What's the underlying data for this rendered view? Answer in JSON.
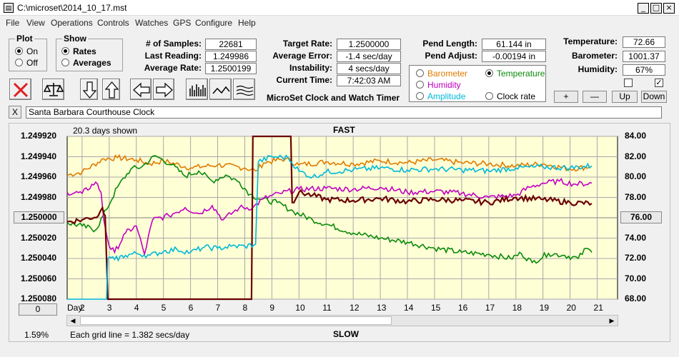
{
  "window": {
    "title": "C:\\microset\\2014_10_17.mst",
    "icon": "app-icon",
    "controls": [
      "_",
      "□",
      "×"
    ]
  },
  "menu": [
    "File",
    "View",
    "Operations",
    "Controls",
    "Watches",
    "GPS",
    "Configure",
    "Help"
  ],
  "plot_group": {
    "title": "Plot",
    "options": [
      "On",
      "Off"
    ],
    "selected": "On"
  },
  "show_group": {
    "title": "Show",
    "options": [
      "Rates",
      "Averages"
    ],
    "selected": "Rates"
  },
  "stats": {
    "samples_label": "# of Samples:",
    "samples": "22681",
    "last_reading_label": "Last Reading:",
    "last_reading": "1.249986",
    "average_rate_label": "Average Rate:",
    "average_rate": "1.2500199",
    "target_rate_label": "Target Rate:",
    "target_rate": "1.2500000",
    "average_error_label": "Average Error:",
    "average_error": "-1.4 sec/day",
    "instability_label": "Instability:",
    "instability": "4 secs/day",
    "current_time_label": "Current Time:",
    "current_time": "7:42:03 AM",
    "pend_length_label": "Pend Length:",
    "pend_length": "61.144 in",
    "pend_adjust_label": "Pend Adjust:",
    "pend_adjust": "-0.00194 in",
    "temperature_label": "Temperature:",
    "temperature": "72.66",
    "barometer_label": "Barometer:",
    "barometer": "1001.37",
    "humidity_label": "Humidity:",
    "humidity": "67%"
  },
  "app_name": "MicroSet Clock and Watch Timer",
  "sensor_group": {
    "options": [
      {
        "label": "Barometer",
        "color": "#e07b00",
        "selected": false
      },
      {
        "label": "Temperature",
        "color": "#0a8a0a",
        "selected": true
      },
      {
        "label": "Humidity",
        "color": "#c000c0",
        "selected": false
      },
      {
        "label": "Clock rate",
        "color": "#000000",
        "selected": false
      },
      {
        "label": "Amplitude",
        "color": "#00b8d8",
        "selected": false
      }
    ]
  },
  "adjust_buttons": [
    "+",
    "—",
    "Up",
    "Down"
  ],
  "clock_name": "Santa Barbara Courthouse Clock",
  "close_label": "X",
  "graph": {
    "days_shown": "20.3 days shown",
    "fast_label": "FAST",
    "slow_label": "SLOW",
    "grid_note": "Each grid line = 1.382 secs/day",
    "percent": "1.59%",
    "day_label": "Day:",
    "center_left_button": "1.250000",
    "center_right_button": "76.00",
    "zero_button": "0"
  },
  "chart_data": {
    "type": "line",
    "x_label": "Day:",
    "x_ticks": [
      2,
      3,
      4,
      5,
      6,
      7,
      8,
      9,
      10,
      11,
      12,
      13,
      14,
      15,
      16,
      17,
      18,
      19,
      20,
      21
    ],
    "xlim": [
      1.45,
      21.75
    ],
    "y_left_ticks": [
      "1.249920",
      "1.249940",
      "1.249960",
      "1.249980",
      "1.250000",
      "1.250020",
      "1.250040",
      "1.250060",
      "1.250080"
    ],
    "y_left_range": [
      1.24992,
      1.25008
    ],
    "y_right_ticks": [
      "84.00",
      "82.00",
      "80.00",
      "78.00",
      "76.00",
      "74.00",
      "72.00",
      "70.00",
      "68.00"
    ],
    "y_right_range": [
      84,
      68
    ],
    "grid": true,
    "series": [
      {
        "name": "Barometer",
        "color": "#e07b00",
        "points": [
          [
            1.45,
            80.2
          ],
          [
            2.0,
            80.5
          ],
          [
            2.8,
            81.8
          ],
          [
            3.3,
            81.9
          ],
          [
            4.0,
            81.7
          ],
          [
            4.5,
            81.3
          ],
          [
            5.0,
            81.6
          ],
          [
            6.0,
            80.9
          ],
          [
            7.0,
            81.2
          ],
          [
            8.0,
            80.9
          ],
          [
            8.4,
            80.6
          ],
          [
            8.7,
            81.4
          ],
          [
            9.5,
            81.8
          ],
          [
            10.0,
            81.2
          ],
          [
            11.0,
            81.5
          ],
          [
            12.0,
            81.3
          ],
          [
            13.0,
            81.6
          ],
          [
            14.0,
            81.4
          ],
          [
            15.0,
            81.7
          ],
          [
            16.0,
            81.4
          ],
          [
            17.0,
            81.3
          ],
          [
            18.0,
            81.1
          ],
          [
            19.0,
            81.3
          ],
          [
            20.0,
            80.8
          ],
          [
            20.7,
            81.0
          ]
        ]
      },
      {
        "name": "Temperature",
        "color": "#0a8a0a",
        "points": [
          [
            1.45,
            75.5
          ],
          [
            2.0,
            75.2
          ],
          [
            2.5,
            74.8
          ],
          [
            2.9,
            76.8
          ],
          [
            3.3,
            79.0
          ],
          [
            3.8,
            80.8
          ],
          [
            4.2,
            81.0
          ],
          [
            4.7,
            82.1
          ],
          [
            5.3,
            81.2
          ],
          [
            5.8,
            80.1
          ],
          [
            6.3,
            80.6
          ],
          [
            6.8,
            79.6
          ],
          [
            7.3,
            80.2
          ],
          [
            7.8,
            79.5
          ],
          [
            8.2,
            78.3
          ],
          [
            8.6,
            77.8
          ],
          [
            9.2,
            77.5
          ],
          [
            9.8,
            76.6
          ],
          [
            10.5,
            75.8
          ],
          [
            11.2,
            75.2
          ],
          [
            12.0,
            74.5
          ],
          [
            13.0,
            74.0
          ],
          [
            14.0,
            73.6
          ],
          [
            15.0,
            73.0
          ],
          [
            16.0,
            72.6
          ],
          [
            17.0,
            72.4
          ],
          [
            17.8,
            72.0
          ],
          [
            18.2,
            72.5
          ],
          [
            18.6,
            71.6
          ],
          [
            19.2,
            72.5
          ],
          [
            19.8,
            72.3
          ],
          [
            20.3,
            72.0
          ],
          [
            20.6,
            73.0
          ],
          [
            20.8,
            72.6
          ]
        ]
      },
      {
        "name": "Humidity",
        "color": "#c000c0",
        "points": [
          [
            1.45,
            78.5
          ],
          [
            2.0,
            78.4
          ],
          [
            2.5,
            79.5
          ],
          [
            2.7,
            78.5
          ],
          [
            2.8,
            75.8
          ],
          [
            3.0,
            73.2
          ],
          [
            3.2,
            72.6
          ],
          [
            3.6,
            74.5
          ],
          [
            4.0,
            75.2
          ],
          [
            4.3,
            72.4
          ],
          [
            4.6,
            75.8
          ],
          [
            5.2,
            76.2
          ],
          [
            5.8,
            77.0
          ],
          [
            6.3,
            76.4
          ],
          [
            6.8,
            77.2
          ],
          [
            7.2,
            75.8
          ],
          [
            7.8,
            77.0
          ],
          [
            8.3,
            77.0
          ],
          [
            8.7,
            77.9
          ],
          [
            9.3,
            78.4
          ],
          [
            10.0,
            78.8
          ],
          [
            11.0,
            78.9
          ],
          [
            12.0,
            78.8
          ],
          [
            13.0,
            79.0
          ],
          [
            14.0,
            78.5
          ],
          [
            15.0,
            78.6
          ],
          [
            16.0,
            78.4
          ],
          [
            17.0,
            78.0
          ],
          [
            18.0,
            78.2
          ],
          [
            18.5,
            79.0
          ],
          [
            19.0,
            79.4
          ],
          [
            19.6,
            79.6
          ],
          [
            20.2,
            79.3
          ],
          [
            20.8,
            79.4
          ]
        ]
      },
      {
        "name": "Clock rate",
        "color": "#6b0000",
        "points": [
          [
            1.45,
            75.6
          ],
          [
            2.0,
            75.8
          ],
          [
            2.6,
            76.2
          ],
          [
            2.75,
            77.0
          ],
          [
            2.85,
            76.2
          ],
          [
            2.95,
            68.0
          ],
          [
            8.25,
            68.0
          ],
          [
            8.3,
            84.0
          ],
          [
            9.7,
            84.0
          ],
          [
            9.75,
            77.5
          ],
          [
            10.0,
            78.5
          ],
          [
            10.5,
            78.2
          ],
          [
            11.0,
            77.8
          ],
          [
            12.0,
            77.7
          ],
          [
            13.0,
            77.9
          ],
          [
            14.0,
            77.6
          ],
          [
            15.0,
            77.8
          ],
          [
            16.0,
            77.7
          ],
          [
            17.0,
            77.5
          ],
          [
            18.0,
            78.0
          ],
          [
            19.0,
            77.8
          ],
          [
            20.0,
            77.5
          ],
          [
            20.8,
            77.4
          ]
        ]
      },
      {
        "name": "Amplitude",
        "color": "#00b8d8",
        "points": [
          [
            1.45,
            68.0
          ],
          [
            2.9,
            68.0
          ],
          [
            2.95,
            72.0
          ],
          [
            3.2,
            71.9
          ],
          [
            3.6,
            72.3
          ],
          [
            4.0,
            72.5
          ],
          [
            4.5,
            72.3
          ],
          [
            5.0,
            72.7
          ],
          [
            5.5,
            72.9
          ],
          [
            6.0,
            72.6
          ],
          [
            6.5,
            73.1
          ],
          [
            7.0,
            73.0
          ],
          [
            7.5,
            73.2
          ],
          [
            8.0,
            73.2
          ],
          [
            8.4,
            73.4
          ],
          [
            8.5,
            81.5
          ],
          [
            9.0,
            82.0
          ],
          [
            9.6,
            81.9
          ],
          [
            10.0,
            80.6
          ],
          [
            10.5,
            80.0
          ],
          [
            11.0,
            80.5
          ],
          [
            12.0,
            80.7
          ],
          [
            13.0,
            80.9
          ],
          [
            14.0,
            80.7
          ],
          [
            15.0,
            80.8
          ],
          [
            16.0,
            80.7
          ],
          [
            17.0,
            80.6
          ],
          [
            18.0,
            80.9
          ],
          [
            19.0,
            81.0
          ],
          [
            20.0,
            80.9
          ],
          [
            20.8,
            81.1
          ]
        ]
      }
    ]
  }
}
